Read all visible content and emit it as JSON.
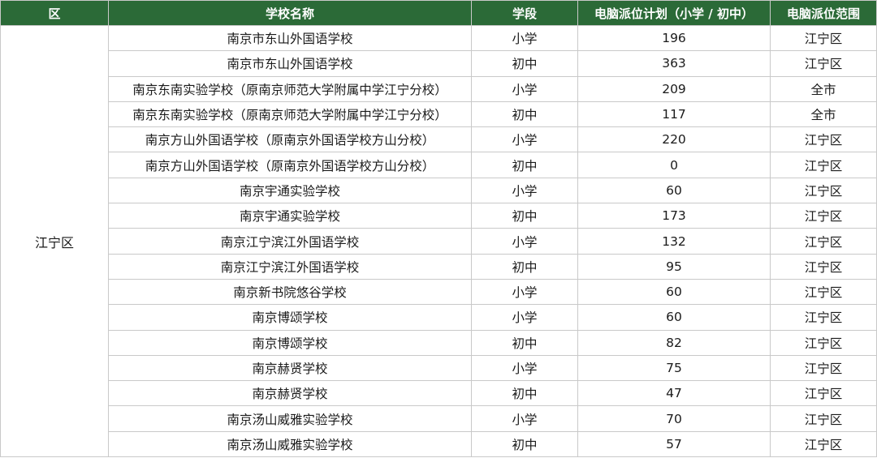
{
  "headers": [
    "区",
    "学校名称",
    "学段",
    "电脑派位计划（小学 / 初中）",
    "电脑派位范围"
  ],
  "district": "江宁区",
  "rows": [
    {
      "school": "南京市东山外国语学校",
      "stage": "小学",
      "plan": "196",
      "range": "江宁区"
    },
    {
      "school": "南京市东山外国语学校",
      "stage": "初中",
      "plan": "363",
      "range": "江宁区"
    },
    {
      "school": "南京东南实验学校（原南京师范大学附属中学江宁分校）",
      "stage": "小学",
      "plan": "209",
      "range": "全市"
    },
    {
      "school": "南京东南实验学校（原南京师范大学附属中学江宁分校）",
      "stage": "初中",
      "plan": "117",
      "range": "全市"
    },
    {
      "school": "南京方山外国语学校（原南京外国语学校方山分校）",
      "stage": "小学",
      "plan": "220",
      "range": "江宁区"
    },
    {
      "school": "南京方山外国语学校（原南京外国语学校方山分校）",
      "stage": "初中",
      "plan": "0",
      "range": "江宁区"
    },
    {
      "school": "南京宇通实验学校",
      "stage": "小学",
      "plan": "60",
      "range": "江宁区"
    },
    {
      "school": "南京宇通实验学校",
      "stage": "初中",
      "plan": "173",
      "range": "江宁区"
    },
    {
      "school": "南京江宁滨江外国语学校",
      "stage": "小学",
      "plan": "132",
      "range": "江宁区"
    },
    {
      "school": "南京江宁滨江外国语学校",
      "stage": "初中",
      "plan": "95",
      "range": "江宁区"
    },
    {
      "school": "南京新书院悠谷学校",
      "stage": "小学",
      "plan": "60",
      "range": "江宁区"
    },
    {
      "school": "南京博颂学校",
      "stage": "小学",
      "plan": "60",
      "range": "江宁区"
    },
    {
      "school": "南京博颂学校",
      "stage": "初中",
      "plan": "82",
      "range": "江宁区"
    },
    {
      "school": "南京赫贤学校",
      "stage": "小学",
      "plan": "75",
      "range": "江宁区"
    },
    {
      "school": "南京赫贤学校",
      "stage": "初中",
      "plan": "47",
      "range": "江宁区"
    },
    {
      "school": "南京汤山威雅实验学校",
      "stage": "小学",
      "plan": "70",
      "range": "江宁区"
    },
    {
      "school": "南京汤山威雅实验学校",
      "stage": "初中",
      "plan": "57",
      "range": "江宁区"
    }
  ],
  "colors": {
    "header_bg": "#2b6a37",
    "header_text": "#ffffff",
    "border": "#c9c9c9"
  }
}
